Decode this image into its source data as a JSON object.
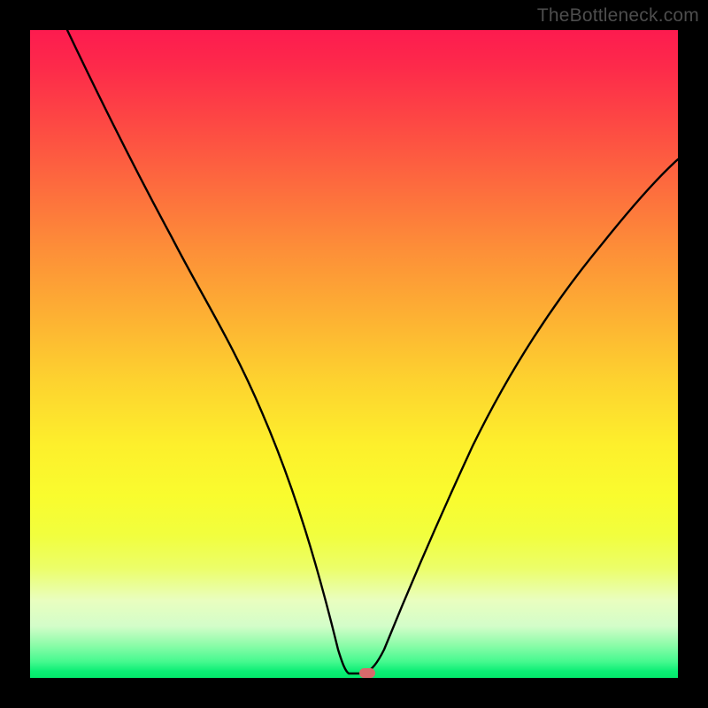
{
  "watermark": "TheBottleneck.com",
  "chart_data": {
    "type": "line",
    "title": "",
    "xlabel": "",
    "ylabel": "",
    "xlim": [
      0,
      100
    ],
    "ylim": [
      0,
      100
    ],
    "grid": false,
    "legend": false,
    "series": [
      {
        "name": "bottleneck-curve",
        "x": [
          0,
          8,
          16,
          24,
          32,
          40,
          46,
          49,
          51,
          53,
          55,
          60,
          66,
          74,
          82,
          90,
          100
        ],
        "values": [
          100,
          88,
          76,
          64,
          50,
          30,
          12,
          2,
          0,
          0,
          1,
          10,
          26,
          44,
          58,
          69,
          80
        ]
      }
    ],
    "marker": {
      "x": 52,
      "y": 0,
      "color": "#d86a6c"
    },
    "gradient_stops": [
      {
        "pos": 0,
        "color": "#fd1b4f"
      },
      {
        "pos": 50,
        "color": "#fdd22f"
      },
      {
        "pos": 80,
        "color": "#f1fe3e"
      },
      {
        "pos": 100,
        "color": "#03e96b"
      }
    ]
  }
}
